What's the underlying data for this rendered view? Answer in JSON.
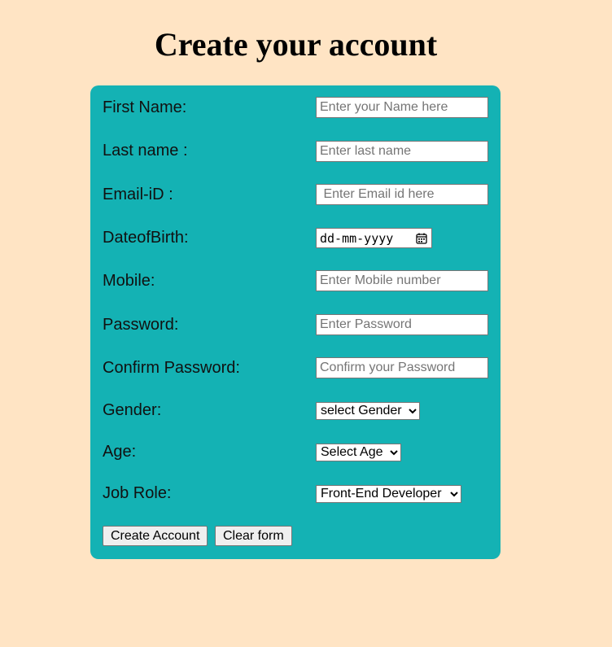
{
  "page": {
    "title": "Create your account"
  },
  "form": {
    "first_name": {
      "label": "First Name:",
      "placeholder": "Enter your Name here"
    },
    "last_name": {
      "label": "Last name :",
      "placeholder": "Enter last name"
    },
    "email": {
      "label": "Email-iD :",
      "placeholder": " Enter Email id here"
    },
    "dob": {
      "label": "DateofBirth:",
      "value": "dd-mm-yyyy",
      "icon": "calendar-icon"
    },
    "mobile": {
      "label": "Mobile:",
      "placeholder": "Enter Mobile number"
    },
    "password": {
      "label": "Password:",
      "placeholder": "Enter Password"
    },
    "confirm_password": {
      "label": "Confirm Password:",
      "placeholder": "Confirm your Password"
    },
    "gender": {
      "label": "Gender:",
      "selected": "select Gender",
      "icon": "chevron-down-icon"
    },
    "age": {
      "label": "Age:",
      "selected": "Select Age",
      "icon": "chevron-down-icon"
    },
    "job_role": {
      "label": "Job Role:",
      "selected": "Front-End Developer",
      "icon": "chevron-down-icon"
    },
    "buttons": {
      "create": "Create Account",
      "clear": "Clear form"
    }
  },
  "colors": {
    "page_background": "#ffe4c4",
    "form_background": "#14b2b4"
  }
}
